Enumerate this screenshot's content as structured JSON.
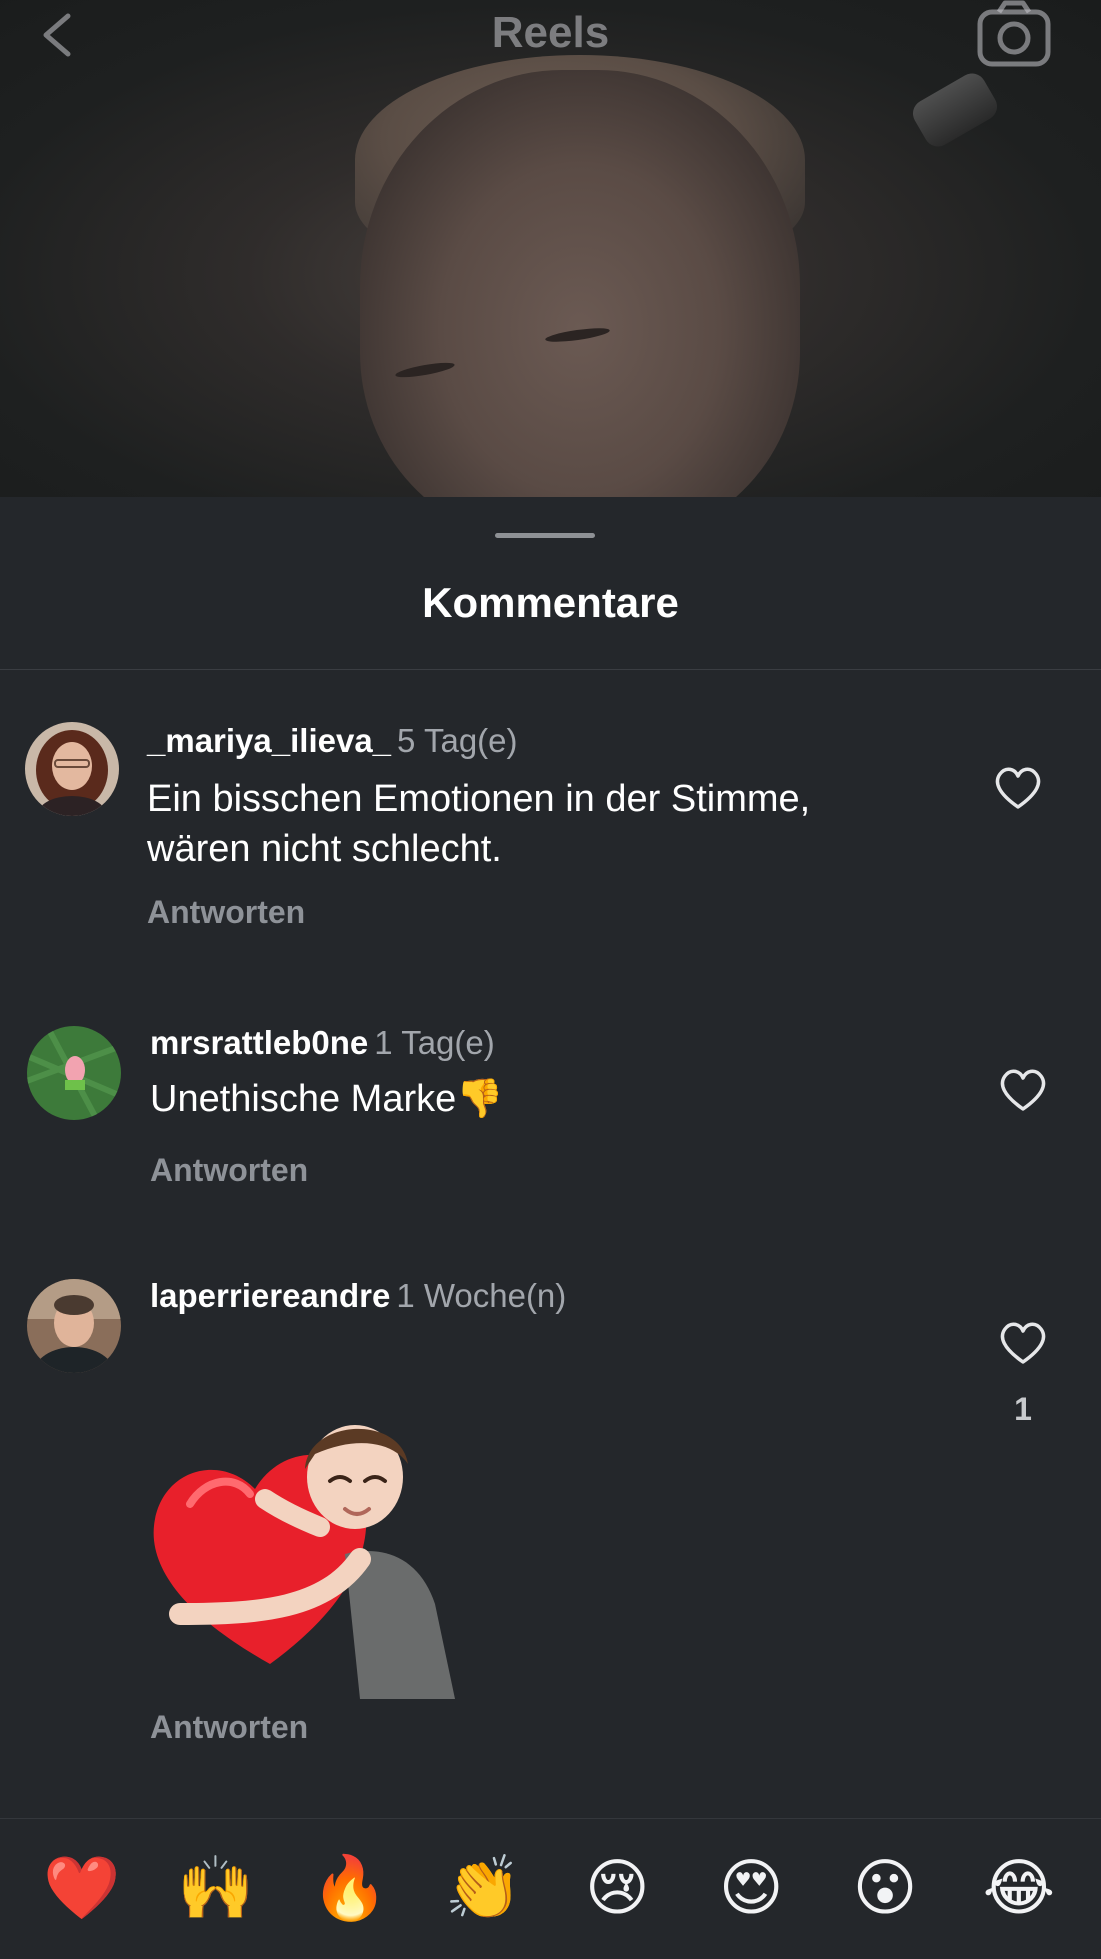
{
  "header": {
    "title": "Reels",
    "back_icon": "chevron-left-icon",
    "camera_icon": "camera-icon"
  },
  "sheet": {
    "title": "Kommentare"
  },
  "comments": [
    {
      "username": "_mariya_ilieva_",
      "time": "5 Tag(e)",
      "text_line1": "Ein bisschen Emotionen in der Stimme,",
      "text_line2": "wären nicht schlecht.",
      "reply_label": "Antworten",
      "like_icon": "heart-outline-icon"
    },
    {
      "username": "mrsrattleb0ne",
      "time": "1 Tag(e)",
      "text": "Unethische Marke👎",
      "reply_label": "Antworten",
      "like_icon": "heart-outline-icon"
    },
    {
      "username": "laperriereandre",
      "time": "1 Woche(n)",
      "sticker": "avatar-hugging-heart-sticker",
      "reply_label": "Antworten",
      "like_icon": "heart-outline-icon",
      "like_count": "1"
    }
  ],
  "emoji_bar": [
    "❤️",
    "🙌",
    "🔥",
    "👏",
    "😢",
    "😍",
    "😮",
    "😂"
  ],
  "colors": {
    "background": "#24272b",
    "text_primary": "#ffffff",
    "text_secondary": "#a2a6ac",
    "reply": "#8e9298"
  }
}
